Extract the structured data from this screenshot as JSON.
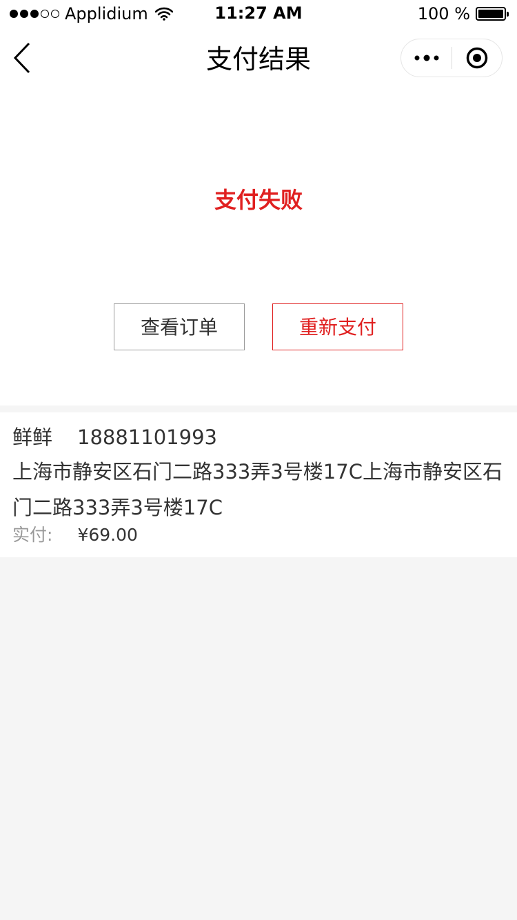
{
  "status_bar": {
    "carrier": "Applidium",
    "time": "11:27 AM",
    "battery": "100 %",
    "signal_full": 3,
    "signal_total": 5
  },
  "nav": {
    "title": "支付结果"
  },
  "result": {
    "title": "支付失败",
    "view_order_label": "查看订单",
    "repay_label": "重新支付",
    "accent_color": "#e02020"
  },
  "order": {
    "name": "鲜鲜",
    "phone": "18881101993",
    "address": "上海市静安区石门二路333弄3号楼17C上海市静安区石门二路333弄3号楼17C",
    "paid_label": "实付:",
    "paid_amount": "¥69.00"
  },
  "icons": [
    "wifi-icon",
    "battery-icon",
    "back-chevron-icon",
    "more-dots-icon",
    "close-target-icon"
  ]
}
